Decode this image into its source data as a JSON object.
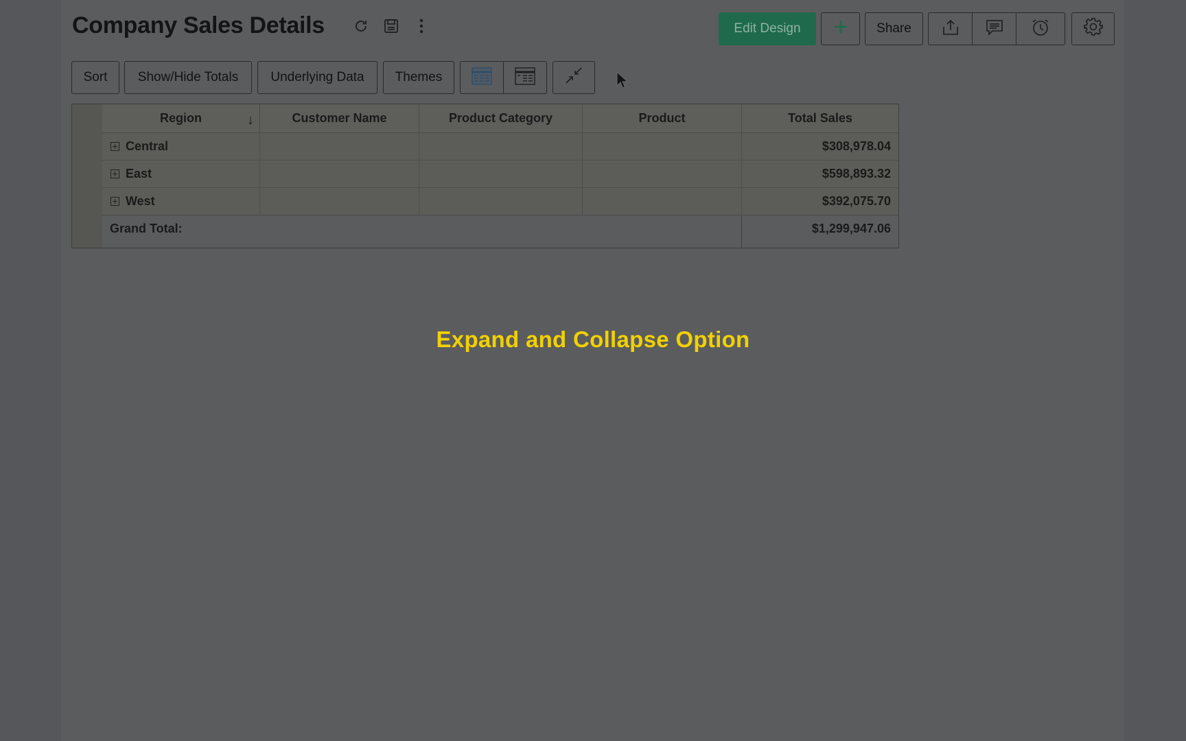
{
  "header": {
    "title": "Company Sales Details",
    "edit_design_label": "Edit Design",
    "share_label": "Share",
    "icons": [
      "refresh-icon",
      "save-icon",
      "more-vertical-icon",
      "add-icon",
      "export-icon",
      "comment-icon",
      "alarm-icon",
      "gear-icon"
    ]
  },
  "toolbar": {
    "sort_label": "Sort",
    "show_hide_totals_label": "Show/Hide Totals",
    "underlying_data_label": "Underlying Data",
    "themes_label": "Themes",
    "icons": [
      "tabular-view-icon",
      "summary-view-icon",
      "collapse-icon"
    ]
  },
  "table": {
    "columns": [
      "Region",
      "Customer Name",
      "Product Category",
      "Product",
      "Total Sales"
    ],
    "sort_indicator": "↓",
    "rows": [
      {
        "region": "Central",
        "total_sales": "$308,978.04"
      },
      {
        "region": "East",
        "total_sales": "$598,893.32"
      },
      {
        "region": "West",
        "total_sales": "$392,075.70"
      }
    ],
    "grand_total_label": "Grand Total:",
    "grand_total_value": "$1,299,947.06"
  },
  "caption": "Expand and Collapse Option",
  "colors": {
    "caption": "#f2d100",
    "edit_button": "#1f6a4c",
    "add_icon": "#1f6a4c"
  }
}
